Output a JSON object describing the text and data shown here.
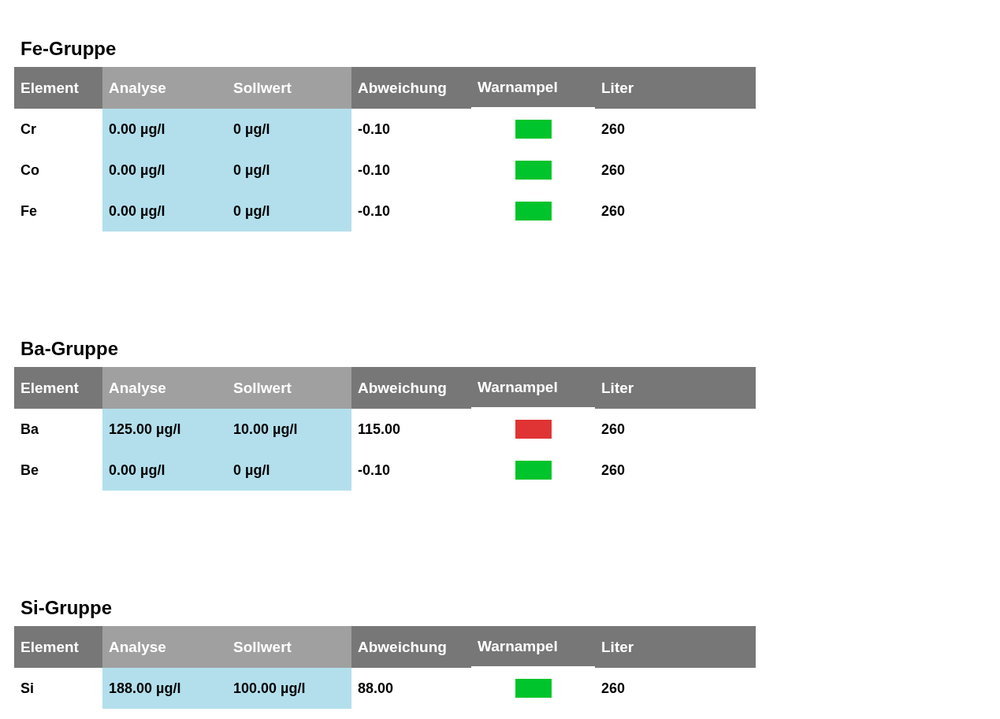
{
  "groups": [
    {
      "title": "Fe-Gruppe",
      "columns": [
        {
          "label": "Element",
          "highlighted": false
        },
        {
          "label": "Analyse",
          "highlighted": true
        },
        {
          "label": "Sollwert",
          "highlighted": true
        },
        {
          "label": "Abweichung",
          "highlighted": false
        },
        {
          "label": "Warnampel",
          "highlighted": false
        },
        {
          "label": "Liter",
          "highlighted": false
        }
      ],
      "rows": [
        {
          "element": "Cr",
          "analyse": "0.00 µg/l",
          "sollwert": "0 µg/l",
          "abweichung": "-0.10",
          "color": "#00c42b",
          "liter": "260"
        },
        {
          "element": "Co",
          "analyse": "0.00 µg/l",
          "sollwert": "0 µg/l",
          "abweichung": "-0.10",
          "color": "#00c42b",
          "liter": "260"
        },
        {
          "element": "Fe",
          "analyse": "0.00 µg/l",
          "sollwert": "0 µg/l",
          "abweichung": "-0.10",
          "color": "#00c42b",
          "liter": "260"
        }
      ]
    },
    {
      "title": "Ba-Gruppe",
      "columns": [
        {
          "label": "Element",
          "highlighted": false
        },
        {
          "label": "Analyse",
          "highlighted": true
        },
        {
          "label": "Sollwert",
          "highlighted": true
        },
        {
          "label": "Abweichung",
          "highlighted": false
        },
        {
          "label": "Warnampel",
          "highlighted": false
        },
        {
          "label": "Liter",
          "highlighted": false
        }
      ],
      "rows": [
        {
          "element": "Ba",
          "analyse": "125.00 µg/l",
          "sollwert": "10.00 µg/l",
          "abweichung": "115.00",
          "color": "#e03333",
          "liter": "260"
        },
        {
          "element": "Be",
          "analyse": "0.00 µg/l",
          "sollwert": "0 µg/l",
          "abweichung": "-0.10",
          "color": "#00c42b",
          "liter": "260"
        }
      ]
    },
    {
      "title": "Si-Gruppe",
      "columns": [
        {
          "label": "Element",
          "highlighted": false
        },
        {
          "label": "Analyse",
          "highlighted": true
        },
        {
          "label": "Sollwert",
          "highlighted": true
        },
        {
          "label": "Abweichung",
          "highlighted": false
        },
        {
          "label": "Warnampel",
          "highlighted": false
        },
        {
          "label": "Liter",
          "highlighted": false
        }
      ],
      "rows": [
        {
          "element": "Si",
          "analyse": "188.00 µg/l",
          "sollwert": "100.00 µg/l",
          "abweichung": "88.00",
          "color": "#00c42b",
          "liter": "260"
        }
      ]
    }
  ]
}
